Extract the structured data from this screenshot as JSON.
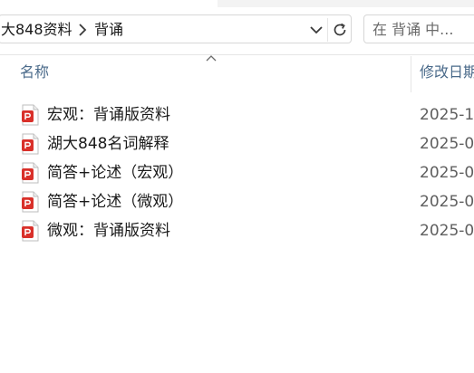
{
  "address_bar": {
    "crumbs": [
      "大848资料",
      "背诵"
    ]
  },
  "search": {
    "placeholder": "在 背诵 中..."
  },
  "columns": {
    "name": "名称",
    "date": "修改日期"
  },
  "files": [
    {
      "name": "宏观：背诵版资料",
      "date": "2025-1"
    },
    {
      "name": "湖大848名词解释",
      "date": "2025-0"
    },
    {
      "name": "简答+论述（宏观）",
      "date": "2025-0"
    },
    {
      "name": "简答+论述（微观）",
      "date": "2025-0"
    },
    {
      "name": "微观：背诵版资料",
      "date": "2025-0"
    }
  ],
  "icons": {
    "crumb_separator": "chevron-right-icon",
    "address_dropdown": "chevron-down-icon",
    "refresh": "refresh-icon",
    "sort": "sort-up-icon",
    "file": "pdf-file-icon"
  },
  "colors": {
    "pdf_red": "#d9302a",
    "header_text": "#4a6a8a"
  }
}
